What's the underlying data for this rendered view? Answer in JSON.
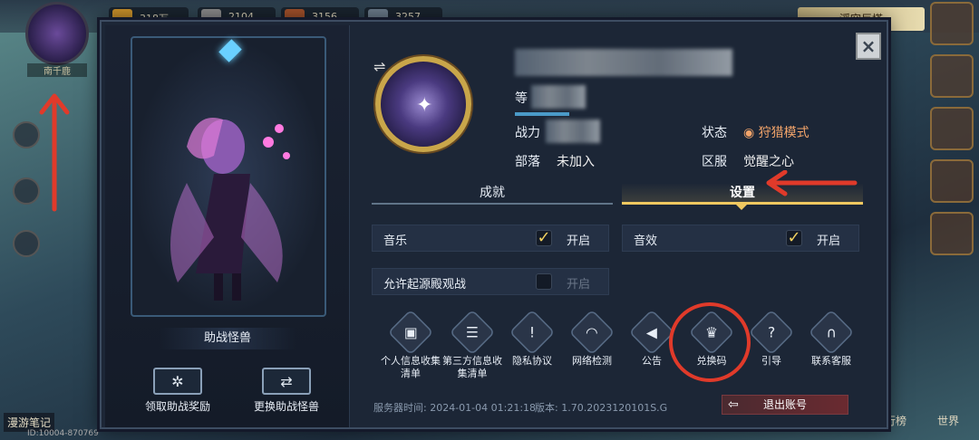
{
  "background": {
    "resources": [
      "318万",
      "2104",
      "3156",
      "3257"
    ],
    "avatar_name": "南千鹿",
    "top_right_title": "浮空巨塔",
    "bottom_left": "漫游笔记",
    "uid": "ID:10004-870769",
    "bottom_right": [
      "行榜",
      "世界"
    ]
  },
  "modal": {
    "close_icon": "×",
    "left": {
      "assist_label": "助战怪兽",
      "claim_reward_label": "领取助战奖励",
      "swap_monster_label": "更换助战怪兽"
    },
    "profile": {
      "level_label": "等",
      "power_label": "战力",
      "tribe_label": "部落",
      "tribe_value": "未加入",
      "status_label": "状态",
      "status_value": "狩猎模式",
      "server_label": "区服",
      "server_value": "觉醒之心"
    },
    "tabs": {
      "achievements": "成就",
      "settings": "设置"
    },
    "settings": {
      "music": {
        "label": "音乐",
        "checked": true,
        "state": "开启"
      },
      "sfx": {
        "label": "音效",
        "checked": true,
        "state": "开启"
      },
      "spectate": {
        "label": "允许起源殿观战",
        "checked": false,
        "state": "开启"
      }
    },
    "buttons": [
      {
        "label": "个人信息收集清单",
        "icon": "id-card-icon"
      },
      {
        "label": "第三方信息收集清单",
        "icon": "list-icon"
      },
      {
        "label": "隐私协议",
        "icon": "shield-icon"
      },
      {
        "label": "网络检测",
        "icon": "wifi-icon"
      },
      {
        "label": "公告",
        "icon": "megaphone-icon"
      },
      {
        "label": "兑换码",
        "icon": "crown-icon"
      },
      {
        "label": "引导",
        "icon": "help-icon"
      },
      {
        "label": "联系客服",
        "icon": "headset-icon"
      }
    ],
    "footer": {
      "server_time_label": "服务器时间:",
      "server_time": "2024-01-04 01:21:18",
      "version_label": "版本:",
      "version": "1.70.2023120101S.G",
      "logout": "退出账号"
    }
  },
  "colors": {
    "accent_gold": "#f0c860",
    "status_orange": "#f2a46a",
    "annotation_red": "#e03a2a"
  }
}
